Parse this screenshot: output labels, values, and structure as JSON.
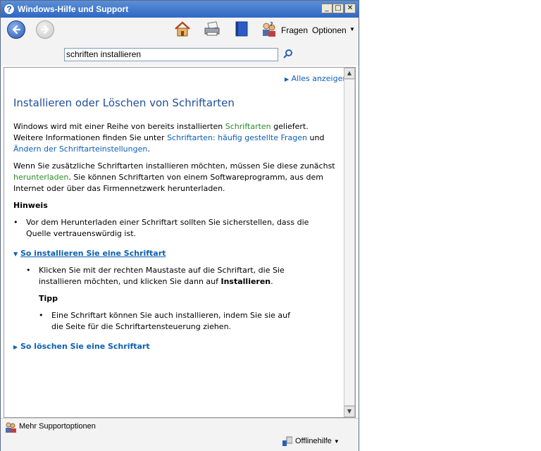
{
  "window": {
    "title": "Windows-Hilfe und Support"
  },
  "toolbar": {
    "ask_label": "Fragen",
    "options_label": "Optionen"
  },
  "search": {
    "value": "schriften installieren"
  },
  "content": {
    "show_all": "Alles anzeigen",
    "heading": "Installieren oder Löschen von Schriftarten",
    "p1_a": "Windows wird mit einer Reihe von bereits installierten ",
    "p1_link1": "Schriftarten",
    "p1_b": " geliefert. Weitere Informationen finden Sie unter ",
    "p1_link2": "Schriftarten: häufig gestellte Fragen",
    "p1_c": " und ",
    "p1_link3": "Ändern der Schriftarteinstellungen",
    "p1_d": ".",
    "p2_a": "Wenn Sie zusätzliche Schriftarten installieren möchten, müssen Sie diese zunächst ",
    "p2_link": "herunterladen",
    "p2_b": ". Sie können Schriftarten von einem Softwareprogramm, aus dem Internet oder über das Firmennetzwerk herunterladen.",
    "note_heading": "Hinweis",
    "note_bullet": "Vor dem Herunterladen einer Schriftart sollten Sie sicherstellen, dass die Quelle vertrauenswürdig ist.",
    "section_install": "So installieren Sie eine Schriftart",
    "install_a": "Klicken Sie mit der rechten Maustaste auf die Schriftart, die Sie installieren möchten, und klicken Sie dann auf ",
    "install_bold": "Installieren",
    "install_b": ".",
    "tip_heading": "Tipp",
    "tip_bullet": "Eine Schriftart können Sie auch installieren, indem Sie sie auf die Seite für die Schriftartensteuerung ziehen.",
    "section_delete": "So löschen Sie eine Schriftart"
  },
  "status": {
    "more_support": "Mehr Supportoptionen",
    "offline_help": "Offlinehilfe"
  }
}
